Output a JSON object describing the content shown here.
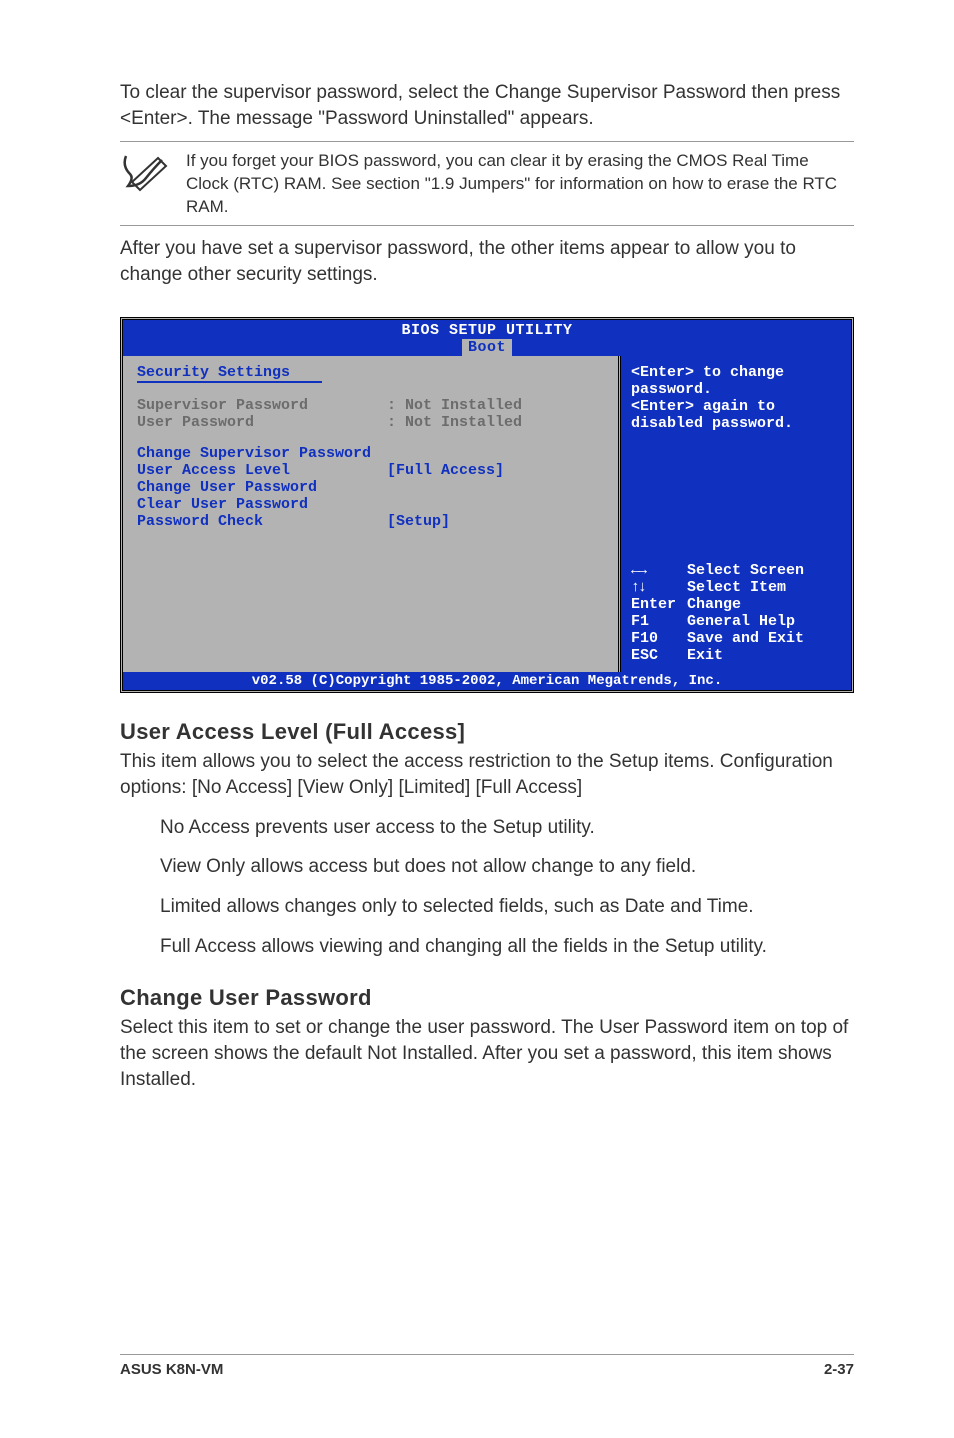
{
  "intro_para": "To clear the supervisor password, select the Change Supervisor Password then press <Enter>. The message \"Password Uninstalled\" appears.",
  "note_text": "If you forget your BIOS password, you can clear it by erasing the CMOS Real Time Clock (RTC) RAM. See section \"1.9  Jumpers\" for information on how to erase the RTC RAM.",
  "after_para": "After you have set a supervisor password, the other items appear to allow you to change other security settings.",
  "bios": {
    "title": "BIOS SETUP UTILITY",
    "tab": "Boot",
    "section_title": "Security Settings",
    "sup_label": "Supervisor Password",
    "sup_val": ": Not Installed",
    "user_label": "User Password",
    "user_val": ": Not Installed",
    "chg_sup": "Change Supervisor Password",
    "ual_label": "User Access Level",
    "ual_val": "[Full Access]",
    "chg_user": "Change User Password",
    "clr_user": "Clear User Password",
    "pwc_label": "Password Check",
    "pwc_val": "[Setup]",
    "help1": "<Enter> to change password.",
    "help2": "<Enter> again to disabled password.",
    "nav_screen": "Select Screen",
    "nav_item": "Select Item",
    "nav_change_k": "Enter",
    "nav_change": "Change",
    "nav_f1": "General Help",
    "nav_f10": "Save and Exit",
    "nav_esc": "Exit",
    "footer": "v02.58 (C)Copyright 1985-2002, American Megatrends, Inc."
  },
  "ual_heading": "User Access Level (Full Access]",
  "ual_body": "This item allows you to select the access restriction to the Setup items. Configuration options: [No Access] [View Only] [Limited] [Full Access]",
  "opt1": "No Access prevents user access to the Setup utility.",
  "opt2": "View Only allows access but does not allow change to any field.",
  "opt3": "Limited allows changes only to selected fields, such as Date and Time.",
  "opt4": "Full Access allows viewing and changing all the fields in the Setup utility.",
  "cup_heading": "Change User Password",
  "cup_body": "Select this item to set or change the user password. The User Password item on top of the screen shows the default Not Installed. After you set a password, this item shows Installed.",
  "footer_left": "ASUS K8N-VM",
  "footer_right": "2-37"
}
